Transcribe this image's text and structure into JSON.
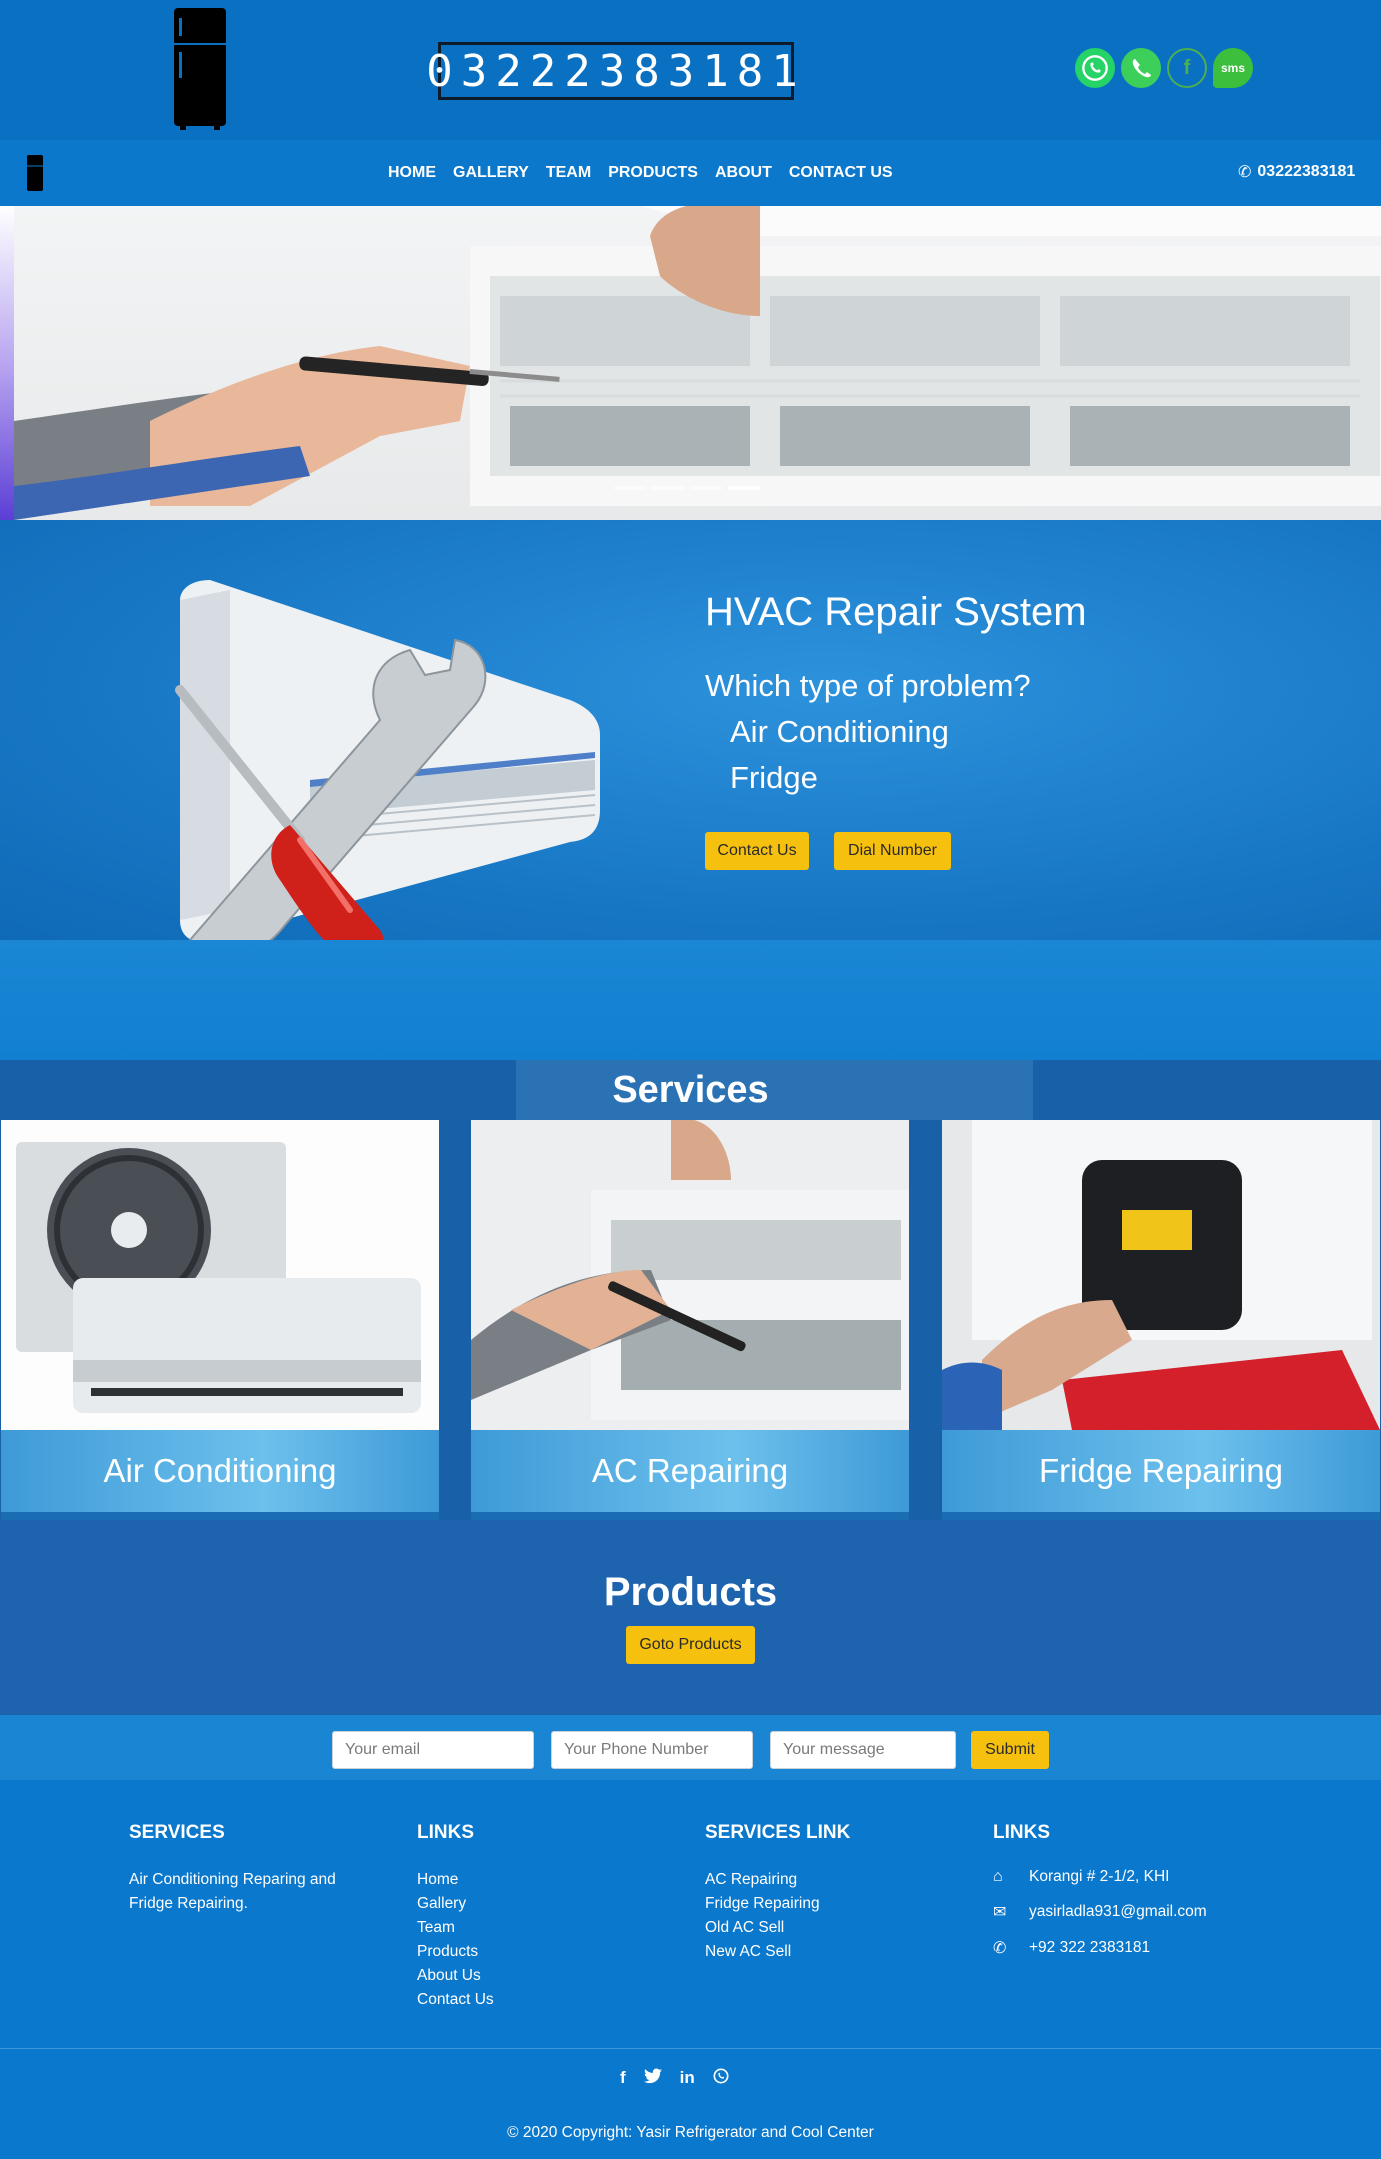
{
  "top_header": {
    "phone_display": "03222383181",
    "social": [
      {
        "name": "whatsapp-icon",
        "color": "#25d366"
      },
      {
        "name": "phone-call-icon",
        "color": "#2ecc71"
      },
      {
        "name": "facebook-icon",
        "color": "#4caf50"
      },
      {
        "name": "sms-icon",
        "color": "#3cbf3c",
        "text": "sms"
      }
    ]
  },
  "nav": {
    "links": [
      "HOME",
      "GALLERY",
      "TEAM",
      "PRODUCTS",
      "ABOUT",
      "CONTACT US"
    ],
    "phone": "03222383181"
  },
  "hvac": {
    "title": "HVAC Repair System",
    "question": "Which type of problem?",
    "problems": [
      "Air Conditioning",
      "Fridge"
    ],
    "contact_btn": "Contact Us",
    "dial_btn": "Dial Number"
  },
  "services": {
    "title": "Services",
    "cards": [
      {
        "label": "Air Conditioning"
      },
      {
        "label": "AC Repairing"
      },
      {
        "label": "Fridge Repairing"
      }
    ]
  },
  "products": {
    "title": "Products",
    "button": "Goto Products"
  },
  "form": {
    "email_placeholder": "Your email",
    "phone_placeholder": "Your Phone Number",
    "message_placeholder": "Your message",
    "submit": "Submit"
  },
  "footer": {
    "services_heading": "SERVICES",
    "services_text": "Air Conditioning Reparing and Fridge Repairing.",
    "links_heading": "LINKS",
    "links": [
      "Home",
      "Gallery",
      "Team",
      "Products",
      "About Us",
      "Contact Us"
    ],
    "services_link_heading": "SERVICES LINK",
    "services_links": [
      "AC Repairing",
      "Fridge Repairing",
      "Old AC Sell",
      "New AC Sell"
    ],
    "contact_heading": "LINKS",
    "address": "Korangi # 2-1/2, KHI",
    "email": "yasirladla931@gmail.com",
    "phone": "+92 322 2383181",
    "copyright": "© 2020 Copyright: Yasir Refrigerator and Cool Center"
  }
}
